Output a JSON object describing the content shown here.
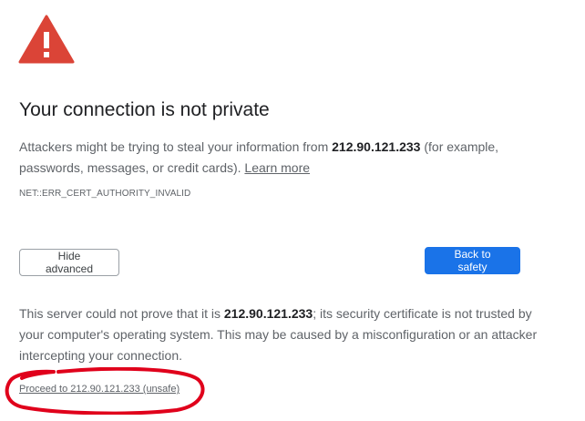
{
  "heading": "Your connection is not private",
  "explanation": {
    "text_before": "Attackers might be trying to steal your information from ",
    "host": "212.90.121.233",
    "text_after": " (for example, passwords, messages, or credit cards). ",
    "learn_more": "Learn more"
  },
  "error_code": "NET::ERR_CERT_AUTHORITY_INVALID",
  "buttons": {
    "hide_advanced": "Hide advanced",
    "back_to_safety": "Back to safety"
  },
  "details": {
    "text_before": "This server could not prove that it is ",
    "host": "212.90.121.233",
    "text_after": "; its security certificate is not trusted by your computer's operating system. This may be caused by a misconfiguration or an attacker intercepting your connection."
  },
  "proceed_link": "Proceed to 212.90.121.233 (unsafe)",
  "colors": {
    "warning_red": "#db4437",
    "primary_blue": "#1a73e8",
    "annotation_red": "#e0001b"
  },
  "icons": {
    "warning": "warning-triangle-icon"
  }
}
